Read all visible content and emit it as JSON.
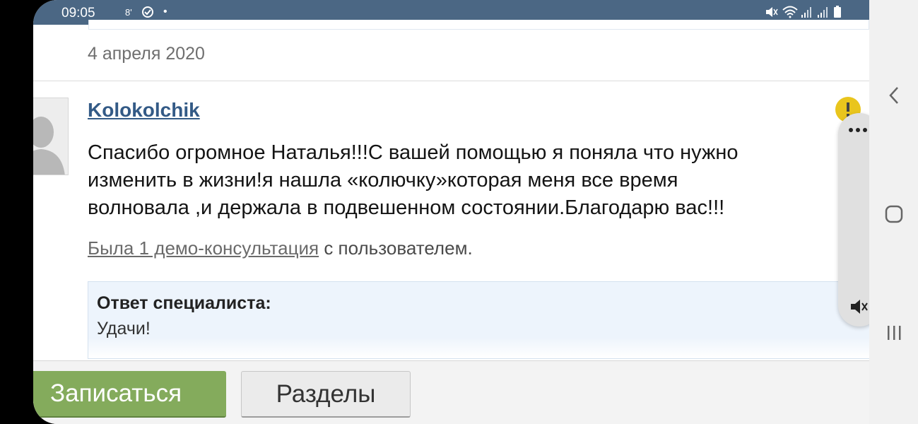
{
  "status_bar": {
    "time": "09:05",
    "icons": [
      "wifi-calling-icon",
      "check-circle-icon",
      "dot-icon",
      "mute-icon",
      "wifi-icon",
      "signal-icon",
      "signal-icon",
      "battery-icon"
    ]
  },
  "post": {
    "date": "4 апреля 2020",
    "username": "Kolokolchik",
    "message_lines": [
      "Спасибо огромное Наталья!!!С вашей помощью я поняла что нужно",
      "изменить в жизни!я нашла «колючку»которая меня все время",
      "волновала ,и держала в подвешенном состоянии.Благодарю вас!!!"
    ],
    "demo_link": "Была 1 демо-консультация",
    "demo_suffix": " с пользователем.",
    "answer_label": "Ответ специалиста:",
    "answer_text": "Удачи!"
  },
  "bottom_bar": {
    "signup_label": "Записаться",
    "sections_label": "Разделы"
  },
  "side_panel": {
    "more_icon": "more-horizontal-icon",
    "mute_icon": "mute-icon"
  },
  "colors": {
    "status_bar": "#4b6784",
    "username_link": "#335a86",
    "signup_button": "#84ab5c",
    "answer_bg": "#edf4fc",
    "report_badge": "#e9c51d"
  }
}
